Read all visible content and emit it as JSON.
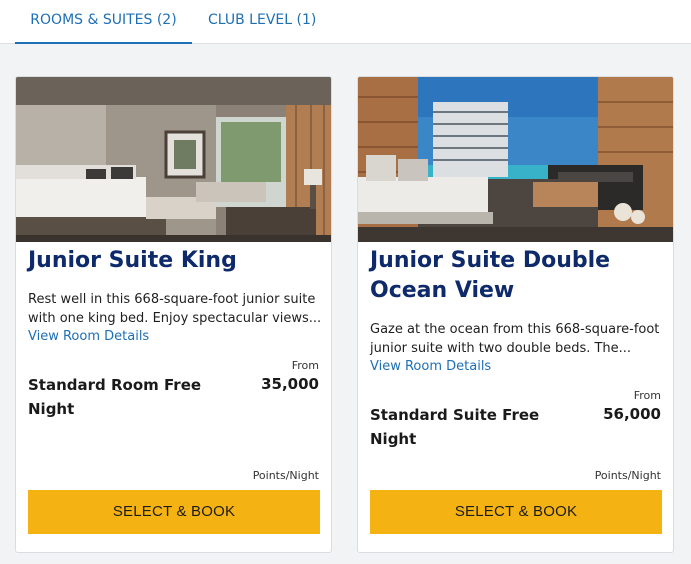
{
  "tabs": [
    {
      "label": "ROOMS & SUITES (2)"
    },
    {
      "label": "CLUB LEVEL (1)"
    }
  ],
  "rooms": [
    {
      "title": "Junior Suite King",
      "description": "Rest well in this 668-square-foot junior suite with one king bed. Enjoy spectacular views...",
      "details_link": "View Room Details",
      "from_label": "From",
      "rate_name": "Standard Room Free Night",
      "points": "35,000",
      "points_unit": "Points/Night",
      "button_label": "SELECT & BOOK"
    },
    {
      "title": "Junior Suite Double Ocean View",
      "description": "Gaze at the ocean from this 668-square-foot junior suite with two double beds. The...",
      "details_link": "View Room Details",
      "from_label": "From",
      "rate_name": "Standard Suite Free Night",
      "points": "56,000",
      "points_unit": "Points/Night",
      "button_label": "SELECT & BOOK"
    }
  ],
  "colors": {
    "accent_blue": "#1f6fb5",
    "title_navy": "#0e2a6b",
    "button_yellow": "#f5b313"
  }
}
